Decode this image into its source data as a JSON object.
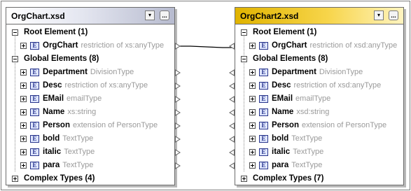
{
  "left_panel": {
    "title": "OrgChart.xsd",
    "root_group": "Root Element (1)",
    "root_items": [
      {
        "name": "OrgChart",
        "type": "restriction of xs:anyType"
      }
    ],
    "global_group": "Global Elements (8)",
    "global_items": [
      {
        "name": "Department",
        "type": "DivisionType"
      },
      {
        "name": "Desc",
        "type": "restriction of xs:anyType"
      },
      {
        "name": "EMail",
        "type": "emailType"
      },
      {
        "name": "Name",
        "type": "xs:string"
      },
      {
        "name": "Person",
        "type": "extension of PersonType"
      },
      {
        "name": "bold",
        "type": "TextType"
      },
      {
        "name": "italic",
        "type": "TextType"
      },
      {
        "name": "para",
        "type": "TextType"
      }
    ],
    "complex_group": "Complex Types (4)"
  },
  "right_panel": {
    "title": "OrgChart2.xsd",
    "root_group": "Root Element (1)",
    "root_items": [
      {
        "name": "OrgChart",
        "type": "restriction of xsd:anyType"
      }
    ],
    "global_group": "Global Elements (8)",
    "global_items": [
      {
        "name": "Department",
        "type": "DivisionType"
      },
      {
        "name": "Desc",
        "type": "restriction of xsd:anyType"
      },
      {
        "name": "EMail",
        "type": "emailType"
      },
      {
        "name": "Name",
        "type": "xsd:string"
      },
      {
        "name": "Person",
        "type": "extension of PersonType"
      },
      {
        "name": "bold",
        "type": "TextType"
      },
      {
        "name": "italic",
        "type": "TextType"
      },
      {
        "name": "para",
        "type": "TextType"
      }
    ],
    "complex_group": "Complex Types (7)"
  },
  "icons": {
    "element": "element-icon",
    "expand": "plus-icon",
    "collapse": "minus-icon",
    "dropdown": "chevron-down-icon",
    "more": "ellipsis-icon"
  },
  "colors": {
    "left_header": "#b7bbcf",
    "right_header": "#f7d54a",
    "element_icon": "#27348b",
    "type_text": "#9a9a9a"
  },
  "header_buttons": {
    "dropdown_glyph": "▾",
    "more_glyph": "..."
  },
  "element_icon_letter": "E"
}
